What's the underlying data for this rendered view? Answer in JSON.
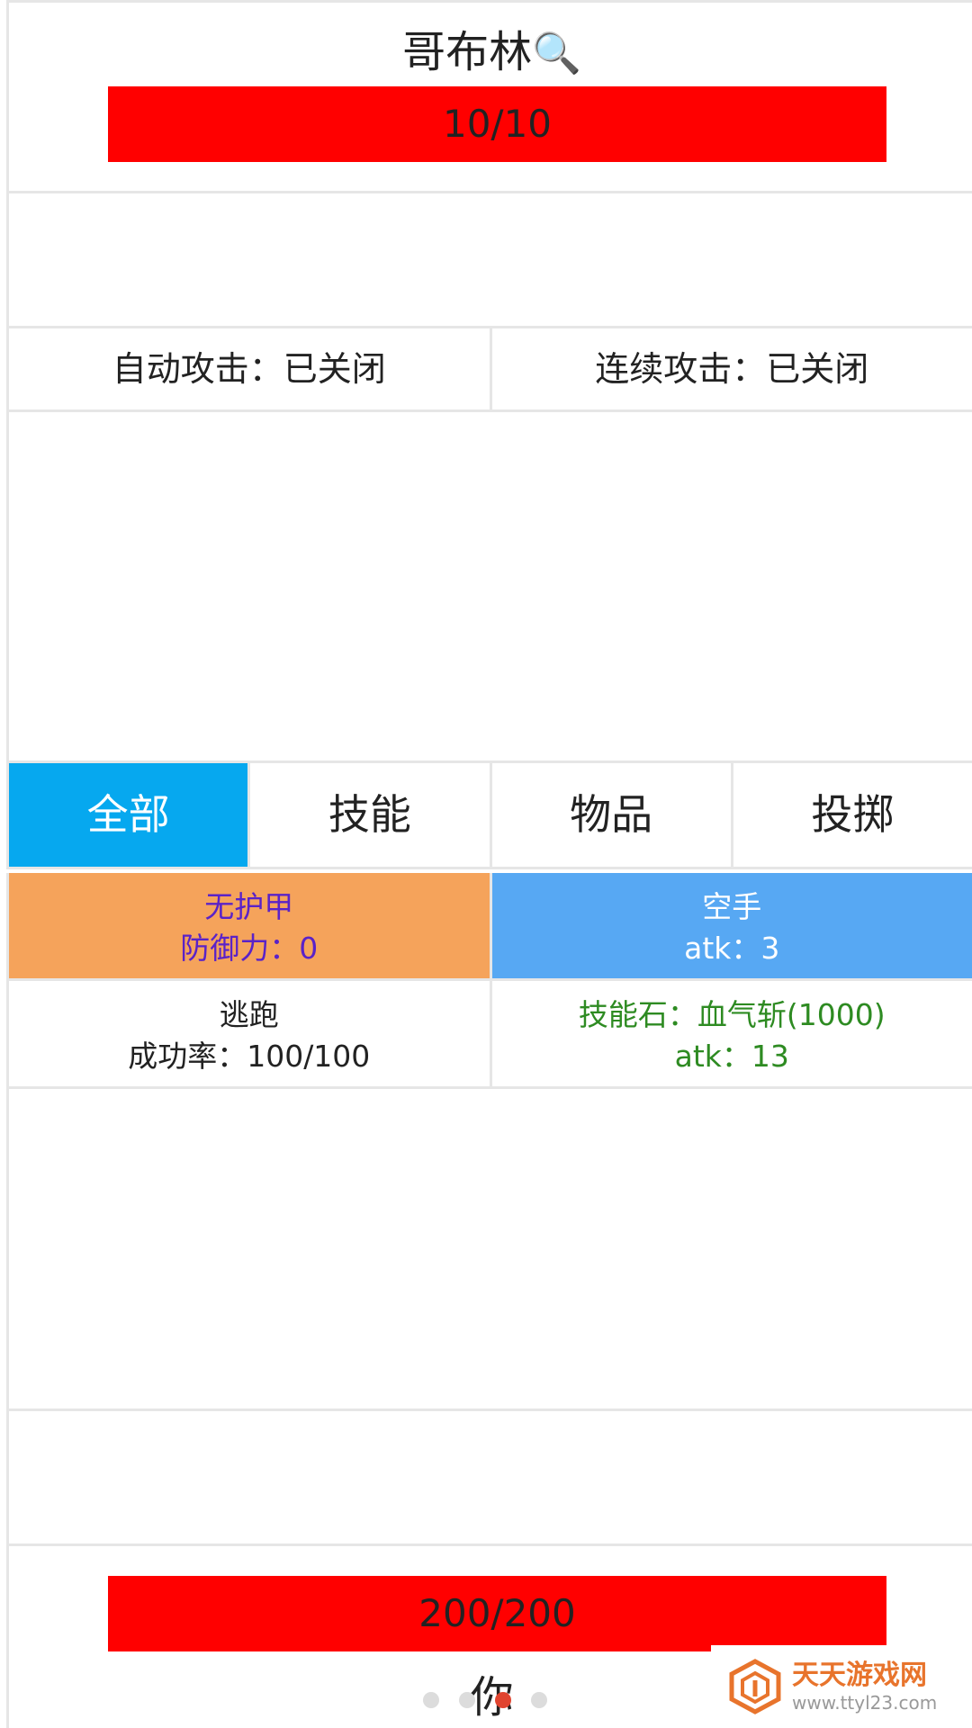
{
  "enemy": {
    "name": "哥布林",
    "inspect_icon": "magnifier-icon",
    "hp": "10/10"
  },
  "toggles": {
    "auto_attack": "自动攻击：已关闭",
    "combo_attack": "连续攻击：已关闭"
  },
  "tabs": [
    {
      "label": "全部",
      "active": true
    },
    {
      "label": "技能",
      "active": false
    },
    {
      "label": "物品",
      "active": false
    },
    {
      "label": "投掷",
      "active": false
    }
  ],
  "actions": {
    "armor": {
      "name": "无护甲",
      "stat": "防御力：0"
    },
    "weapon": {
      "name": "空手",
      "stat": "atk：3"
    },
    "escape": {
      "name": "逃跑",
      "stat": "成功率：100/100"
    },
    "skill": {
      "name": "技能石：血气斩(1000)",
      "stat": "atk：13"
    }
  },
  "player": {
    "hp": "200/200",
    "name": "你"
  },
  "pager": {
    "count": 4,
    "active_index": 2
  },
  "watermark": {
    "title": "天天游戏网",
    "url": "www.ttyl23.com"
  },
  "colors": {
    "hp_bar": "#ff0000",
    "tab_active": "#06a8ef",
    "armor_bg": "#f5a35b",
    "armor_text": "#5a22c8",
    "weapon_bg": "#57a8f3",
    "skill_text": "#2e8b22",
    "pager_active": "#e0442f"
  }
}
